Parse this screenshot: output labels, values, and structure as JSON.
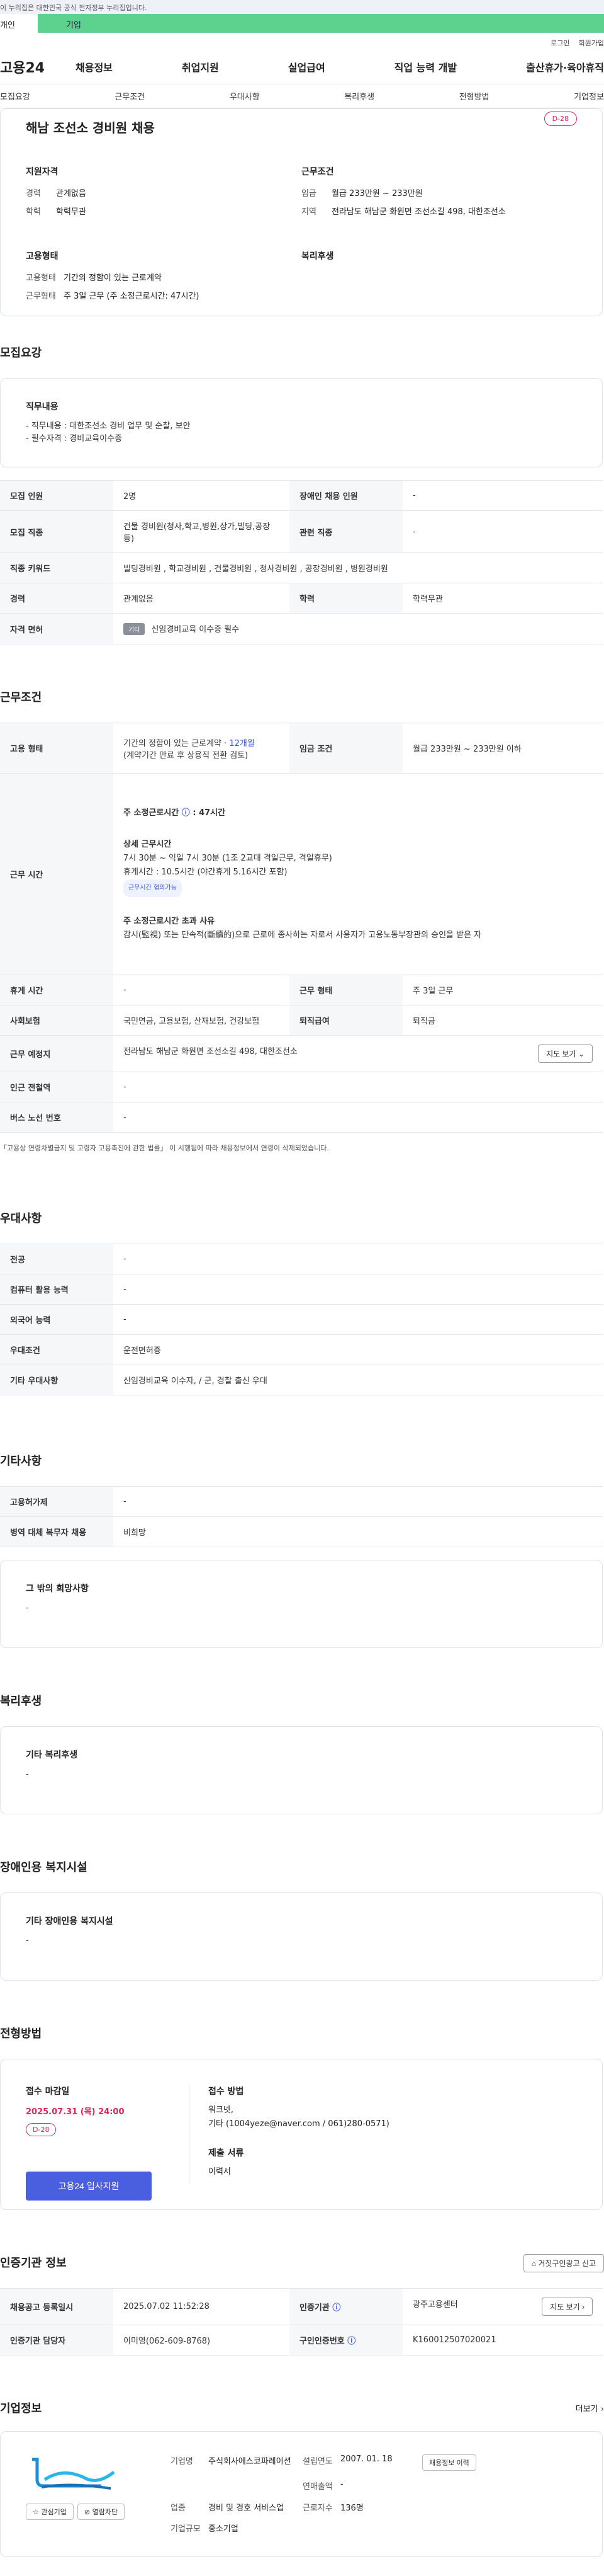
{
  "banner": "이 누리집은 대한민국 공식 전자정부 누리집입니다.",
  "user_tabs": [
    "개인",
    "기업"
  ],
  "util": [
    "로그인",
    "회원가입"
  ],
  "logo": "고용24",
  "gnb": [
    "채용정보",
    "취업지원",
    "실업급여",
    "직업 능력 개발",
    "출산휴가·육아휴직"
  ],
  "subnav": [
    "모집요강",
    "근무조건",
    "우대사항",
    "복리후생",
    "전형방법",
    "기업정보"
  ],
  "job": {
    "title": "해남 조선소 경비원 채용",
    "dday": "D-28",
    "summary": {
      "qual_title": "지원자격",
      "career_k": "경력",
      "career_v": "관계없음",
      "edu_k": "학력",
      "edu_v": "학력무관",
      "cond_title": "근무조건",
      "wage_k": "임금",
      "wage_v": "월급 233만원 ~ 233만원",
      "region_k": "지역",
      "region_v": "전라남도 해남군 화원면 조선소길 498, 대한조선소",
      "emp_title": "고용형태",
      "emp_k1": "고용형태",
      "emp_v1": "기간의 정함이 있는 근로계약",
      "emp_k2": "근무형태",
      "emp_v2": "주 3일 근무 (주 소정근로시간: 47시간)",
      "welfare_title": "복리후생"
    }
  },
  "recruit": {
    "section": "모집요강",
    "duty_title": "직무내용",
    "duty_lines": [
      "- 직무내용 : 대한조선소 경비 업무 및 순찰, 보안",
      "- 필수자격 : 경비교육이수증"
    ],
    "rows": {
      "count_k": "모집 인원",
      "count_v": "2명",
      "disabled_k": "장애인 채용 인원",
      "disabled_v": "-",
      "job_k": "모집 직종",
      "job_v": "건물 경비원(청사,학교,병원,상가,빌딩,공장 등)",
      "rel_k": "관련 직종",
      "rel_v": "-",
      "kw_k": "직종 키워드",
      "kw_v": "빌딩경비원 , 학교경비원 , 건물경비원 , 청사경비원 , 공장경비원 , 병원경비원",
      "career_k": "경력",
      "career_v": "관계없음",
      "edu_k": "학력",
      "edu_v": "학력무관",
      "lic_k": "자격 면허",
      "lic_tag": "기타",
      "lic_v": "신임경비교육 이수증 필수"
    }
  },
  "work": {
    "section": "근무조건",
    "emp_k": "고용 형태",
    "emp_v1": "기간의 정함이 있는 근로계약 · ",
    "emp_months": "12개월",
    "emp_v2": "(계약기간 만료 후 상용직 전환 검토)",
    "wage_k": "임금 조건",
    "wage_v": "월급 233만원 ~ 233만원 이하",
    "time_k": "근무 시간",
    "time_head": "주 소정근로시간",
    "time_hours": "47시간",
    "detail_head": "상세 근무시간",
    "detail_1": "7시 30분 ~ 익일 7시 30분 (1조 2교대 격일근무, 격일휴무)",
    "detail_2": "휴게시간 : 10.5시간 (야간휴게 5.16시간 포함)",
    "detail_pill": "근무시간 협의가능",
    "over_head": "주 소정근로시간 초과 사유",
    "over_text": "감시(監視) 또는 단속적(斷續的)으로 근로에 종사하는 자로서 사용자가 고용노동부장관의 승인을 받은 자",
    "rest_k": "휴게 시간",
    "rest_v": "-",
    "form_k": "근무 형태",
    "form_v": "주 3일 근무",
    "ins_k": "사회보험",
    "ins_v": "국민연금, 고용보험, 산재보험, 건강보험",
    "sev_k": "퇴직급여",
    "sev_v": "퇴직금",
    "place_k": "근무 예정지",
    "place_v": "전라남도 해남군 화원면 조선소길 498, 대한조선소",
    "map_btn": "지도 보기",
    "subway_k": "인근 전철역",
    "subway_v": "-",
    "bus_k": "버스 노선 번호",
    "bus_v": "-",
    "note": "「고용상 연령차별금지 및 고령자 고용촉진에 관한 법률」 이 시행됨에 따라 채용정보에서 연령이 삭제되었습니다."
  },
  "pref": {
    "section": "우대사항",
    "major_k": "전공",
    "major_v": "-",
    "pc_k": "컴퓨터 활용 능력",
    "pc_v": "-",
    "lang_k": "외국어 능력",
    "lang_v": "-",
    "cond_k": "우대조건",
    "cond_v": "운전면허증",
    "etc_k": "기타 우대사항",
    "etc_v": "신임경비교육 이수자, / 군, 경찰 출신 우대"
  },
  "other": {
    "section": "기타사항",
    "sub_k": "고용허가제",
    "sub_v": "-",
    "mil_k": "병역 대체 복무자 채용",
    "mil_v": "비희망",
    "wish_title": "그 밖의 희망사항",
    "wish_v": "-"
  },
  "welfare": {
    "section": "복리후생",
    "title": "기타 복리후생",
    "v": "-"
  },
  "disabled_fac": {
    "section": "장애인용 복지시설",
    "title": "기타 장애인용 복지시설",
    "v": "-"
  },
  "selection": {
    "section": "전형방법",
    "deadline_title": "접수 마감일",
    "deadline": "2025.07.31 (목) 24:00",
    "dday": "D-28",
    "apply_btn": "고용24 입사지원",
    "method_title": "접수 방법",
    "method_1": "워크넷,",
    "method_2": "기타 (1004yeze@naver.com / 061)280-0571)",
    "docs_title": "제출 서류",
    "docs_v": "이력서"
  },
  "agency": {
    "section": "인증기관 정보",
    "report_btn": "거짓구인광고 신고",
    "reg_k": "채용공고 등록일시",
    "reg_v": "2025.07.02 11:52:28",
    "org_k": "인증기관",
    "org_v": "광주고용센터",
    "map_btn": "지도 보기",
    "mgr_k": "인증기관 담당자",
    "mgr_v": "이미영(062-609-8768)",
    "num_k": "구인인증번호",
    "num_v": "K160012507020021"
  },
  "company": {
    "section": "기업정보",
    "more": "더보기",
    "fav_btn": "관심기업",
    "block_btn": "열람차단",
    "name_k": "기업명",
    "name_v": "주식회사에스코파레이션",
    "est_k": "설립연도",
    "est_v": "2007. 01. 18",
    "sales_k": "연매출액",
    "sales_v": "-",
    "ind_k": "업종",
    "ind_v": "경비 및 경호 서비스업",
    "emp_k": "근로자수",
    "emp_v": "136명",
    "type_k": "기업규모",
    "type_v": "중소기업",
    "jobs_btn": "채용정보 이력"
  },
  "colors": {
    "accent": "#4a5fe0",
    "dday": "#e0245e",
    "green": "#5dd18e"
  }
}
